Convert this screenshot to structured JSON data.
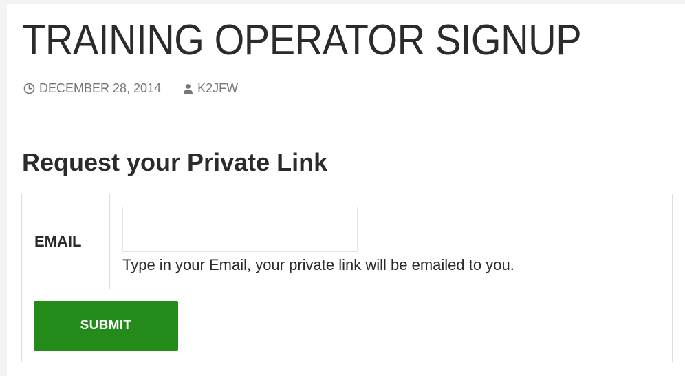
{
  "post": {
    "title": "TRAINING OPERATOR SIGNUP",
    "date": "DECEMBER 28, 2014",
    "author": "K2JFW",
    "date_icon": "clock-icon",
    "author_icon": "user-icon"
  },
  "form": {
    "heading": "Request your Private Link",
    "email_label": "EMAIL",
    "email_value": "",
    "email_placeholder": "",
    "help_text": "Type in your Email, your private link will be emailed to you.",
    "submit_label": "SUBMIT"
  },
  "colors": {
    "submit_background": "#248a1a",
    "meta_text": "#767676",
    "border": "#dedede"
  }
}
